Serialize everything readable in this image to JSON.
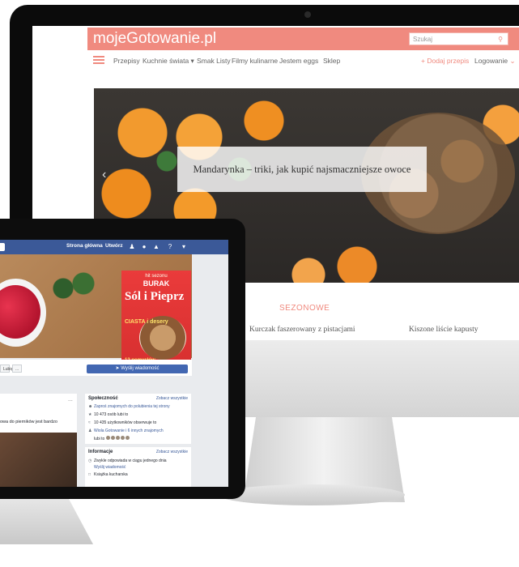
{
  "desktop_site": {
    "logo": "mojeGotowanie.pl",
    "search_placeholder": "Szukaj",
    "nav": [
      "Przepisy",
      "Kuchnie świata",
      "Smak Listy",
      "Filmy kulinarne",
      "Jestem eggs",
      "Sklep"
    ],
    "nav_dropdown_index": 1,
    "add_recipe": "+ Dodaj przepis",
    "login": "Logowanie",
    "hero_caption": "Mandarynka – triki, jak kupić najsmaczniejsze owoce",
    "seasonal_label": "SEZONOWE",
    "recipes": [
      "Kurczak faszerowany z pistacjami",
      "Kiszone liście kapusty"
    ],
    "colors": {
      "brand": "#f08a7f"
    }
  },
  "facebook_page": {
    "top_nav": {
      "home": "Strona główna",
      "create": "Utwórz"
    },
    "magazine": {
      "kicker": "hit sezonu",
      "headline": "BURAK",
      "title": "Sól i Pieprz",
      "cover_line": "CIASTA i desery",
      "bottom_line": "12 pomysłów"
    },
    "buttons": {
      "more": "...",
      "send_message": "Wyślij wiadomość",
      "small": "Lubię"
    },
    "post": {
      "text": "owa do pierników jest bardzo",
      "menu": "..."
    },
    "community": {
      "heading": "Społeczność",
      "see_all": "Zobacz wszystkie",
      "rows": [
        "Zaproś znajomych do polubienia tej strony",
        "10 473 osób lubi to",
        "10 435 użytkowników obserwuje to",
        "Wiola Gotowanie i 6 innych znajomych",
        "lubi to"
      ]
    },
    "info": {
      "heading": "Informacje",
      "see_all": "Zobacz wszystkie",
      "rows": [
        "Zwykle odpowiada w ciągu jednego dnia",
        "Wyślij wiadomość",
        "Książka kucharska"
      ]
    },
    "colors": {
      "facebook_blue": "#3b5998",
      "button_blue": "#4267b2"
    }
  }
}
